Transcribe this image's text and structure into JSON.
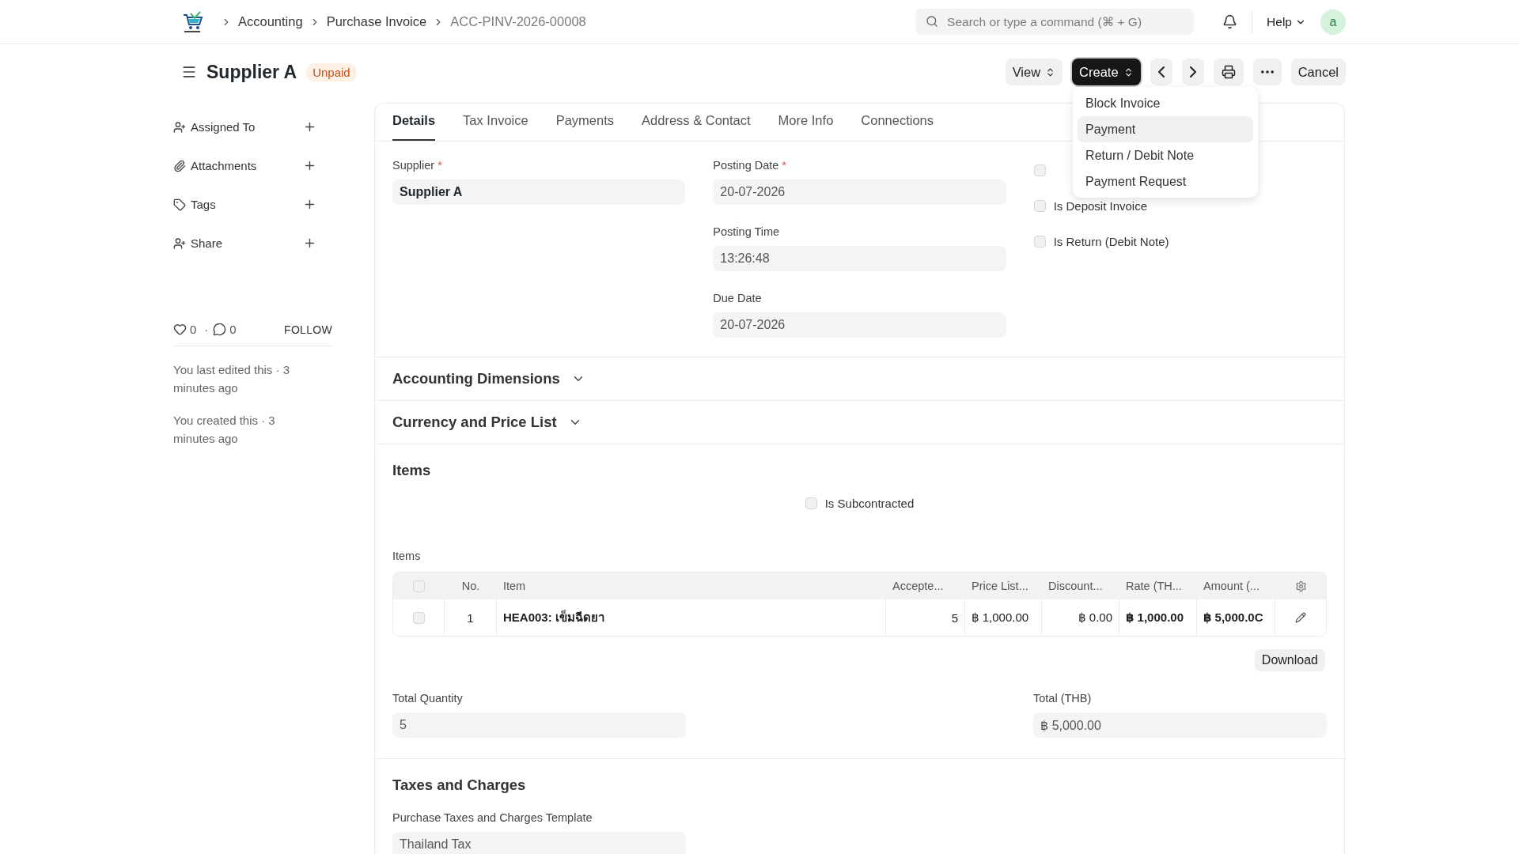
{
  "breadcrumbs": [
    "Accounting",
    "Purchase Invoice",
    "ACC-PINV-2026-00008"
  ],
  "search": {
    "placeholder": "Search or type a command (⌘ + G)"
  },
  "help": "Help",
  "avatar": "a",
  "header": {
    "title": "Supplier A",
    "status": "Unpaid"
  },
  "toolbar": {
    "view": "View",
    "create": "Create",
    "cancel": "Cancel"
  },
  "create_menu": [
    {
      "label": "Block Invoice",
      "selected": false
    },
    {
      "label": "Payment",
      "selected": true
    },
    {
      "label": "Return / Debit Note",
      "selected": false
    },
    {
      "label": "Payment Request",
      "selected": false
    }
  ],
  "sidebar": {
    "items": [
      {
        "kind": "assign",
        "label": "Assigned To"
      },
      {
        "kind": "attach",
        "label": "Attachments"
      },
      {
        "kind": "tag",
        "label": "Tags"
      },
      {
        "kind": "share",
        "label": "Share"
      }
    ],
    "likes": "0",
    "separator": "·",
    "comments": "0",
    "follow": "FOLLOW",
    "activity": [
      "You last edited this · 3 minutes ago",
      "You created this · 3 minutes ago"
    ]
  },
  "tabs": [
    {
      "label": "Details",
      "selected": true
    },
    {
      "label": "Tax Invoice",
      "selected": false
    },
    {
      "label": "Payments",
      "selected": false
    },
    {
      "label": "Address & Contact",
      "selected": false
    },
    {
      "label": "More Info",
      "selected": false
    },
    {
      "label": "Connections",
      "selected": false
    }
  ],
  "fields_col1": [
    {
      "label": "Supplier",
      "required_mark": "*",
      "value": "Supplier A",
      "bold": true
    }
  ],
  "fields_col2": [
    {
      "label": "Posting Date",
      "required_mark": "*",
      "value": "20-07-2026"
    },
    {
      "label": "Posting Time",
      "value": "13:26:48"
    },
    {
      "label": "Due Date",
      "value": "20-07-2026"
    }
  ],
  "flags": [
    {
      "checked": false
    },
    {
      "label": "Is Deposit Invoice",
      "checked": false
    },
    {
      "label": "Is Return (Debit Note)",
      "checked": false
    }
  ],
  "sections": [
    {
      "title": "Accounting Dimensions",
      "expanded": false
    },
    {
      "title": "Currency and Price List",
      "expanded": false
    }
  ],
  "items_section": {
    "title": "Items",
    "subcontracted": {
      "label": "Is Subcontracted",
      "checked": false
    },
    "table_label": "Items",
    "select_all_checked": false,
    "columns": [
      "No.",
      "Item",
      "Accepte...",
      "Price List...",
      "Discount...",
      "Rate (TH...",
      "Amount (..."
    ],
    "rows": [
      {
        "selected": false,
        "cells": [
          "1",
          "HEA003: เข็มฉีดยา",
          "5",
          "฿ 1,000.00",
          "฿ 0.00",
          "฿ 1,000.00",
          "฿ 5,000.0C"
        ]
      }
    ],
    "download": "Download",
    "totals": [
      {
        "label": "Total Quantity",
        "value": "5"
      },
      {
        "label": "Total (THB)",
        "value": "฿ 5,000.00"
      }
    ]
  },
  "taxes_section": {
    "title": "Taxes and Charges",
    "template_label": "Purchase Taxes and Charges Template",
    "template_value": "Thailand Tax"
  }
}
